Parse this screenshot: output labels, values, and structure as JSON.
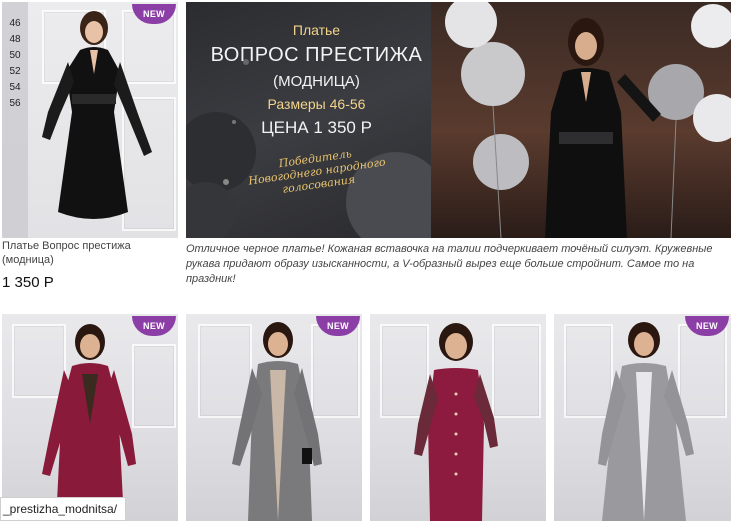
{
  "products": {
    "featured": {
      "badge": "NEW",
      "sizes": [
        "46",
        "48",
        "50",
        "52",
        "54",
        "56"
      ],
      "name": "Платье Вопрос престижа (модница)",
      "price": "1 350 Р"
    },
    "grid": [
      {
        "badge": "NEW",
        "dress_color": "#8a1a3a"
      },
      {
        "badge": "NEW",
        "dress_color": "#7a7a7c"
      },
      {
        "badge": "",
        "dress_color": "#8d1a3f"
      },
      {
        "badge": "NEW",
        "dress_color": "#9a9a9e"
      }
    ]
  },
  "banner": {
    "line1": "Платье",
    "line2": "ВОПРОС ПРЕСТИЖА",
    "line3": "(МОДНИЦА)",
    "line4": "Размеры 46-56",
    "line5": "ЦЕНА 1 350 Р",
    "slogan": "Победитель Новогоднего народного голосования"
  },
  "description": "Отличное черное платье! Кожаная вставочка на талии подчеркивает точёный силуэт. Кружевные рукава придают образу изысканности, а V-образный вырез еще больше стройнит. Самое то на праздник!",
  "status_bar": {
    "url": "_prestizha_modnitsa/"
  },
  "colors": {
    "badge": "#8b3fa6",
    "gold": "#f2d48a"
  }
}
